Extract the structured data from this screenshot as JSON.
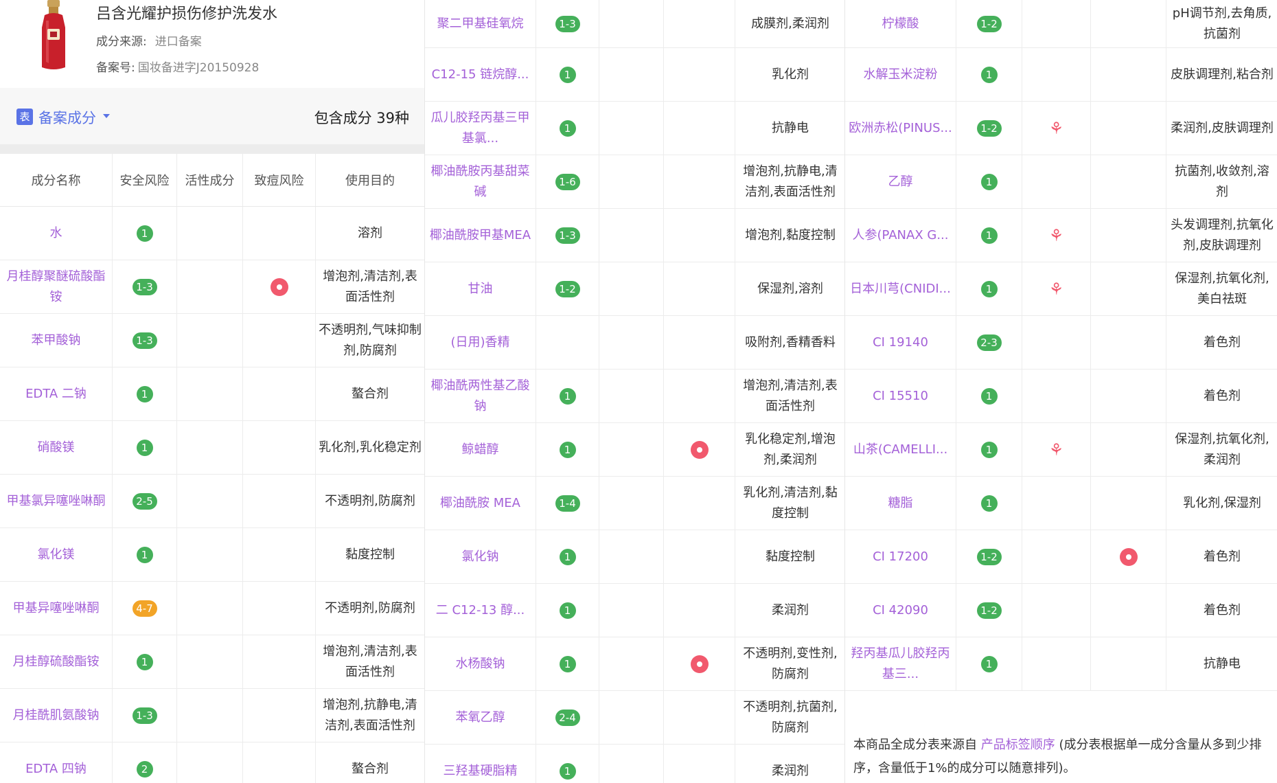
{
  "product": {
    "name": "吕含光耀护损伤修护洗发水",
    "source_label": "成分来源:",
    "source_value": "进口备案",
    "record_label": "备案号:",
    "record_value": "国妆备进字J20150928"
  },
  "section": {
    "icon_text": "表",
    "title": "备案成分",
    "count": "包含成分 39种"
  },
  "headers": [
    "成分名称",
    "安全风险",
    "活性成分",
    "致痘风险",
    "使用目的"
  ],
  "columns": [
    [
      {
        "name": "水",
        "risk": "1",
        "active": false,
        "acne": false,
        "purpose": "溶剂"
      },
      {
        "name": "月桂醇聚醚硫酸酯铵",
        "risk": "1-3",
        "active": false,
        "acne": true,
        "purpose": "增泡剂,清洁剂,表面活性剂"
      },
      {
        "name": "苯甲酸钠",
        "risk": "1-3",
        "active": false,
        "acne": false,
        "purpose": "不透明剂,气味抑制剂,防腐剂"
      },
      {
        "name": "EDTA 二钠",
        "risk": "1",
        "active": false,
        "acne": false,
        "purpose": "螯合剂"
      },
      {
        "name": "硝酸镁",
        "risk": "1",
        "active": false,
        "acne": false,
        "purpose": "乳化剂,乳化稳定剂"
      },
      {
        "name": "甲基氯异噻唑啉酮",
        "risk": "2-5",
        "active": false,
        "acne": false,
        "purpose": "不透明剂,防腐剂"
      },
      {
        "name": "氯化镁",
        "risk": "1",
        "active": false,
        "acne": false,
        "purpose": "黏度控制"
      },
      {
        "name": "甲基异噻唑啉酮",
        "risk": "4-7",
        "risk_level": "orange",
        "active": false,
        "acne": false,
        "purpose": "不透明剂,防腐剂"
      },
      {
        "name": "月桂醇硫酸酯铵",
        "risk": "1",
        "active": false,
        "acne": false,
        "purpose": "增泡剂,清洁剂,表面活性剂"
      },
      {
        "name": "月桂酰肌氨酸钠",
        "risk": "1-3",
        "active": false,
        "acne": false,
        "purpose": "增泡剂,抗静电,清洁剂,表面活性剂"
      },
      {
        "name": "EDTA 四钠",
        "risk": "2",
        "active": false,
        "acne": false,
        "purpose": "螯合剂"
      }
    ],
    [
      {
        "name": "聚二甲基硅氧烷",
        "risk": "1-3",
        "active": false,
        "acne": false,
        "purpose": "成膜剂,柔润剂"
      },
      {
        "name": "C12-15 链烷醇...",
        "risk": "1",
        "active": false,
        "acne": false,
        "purpose": "乳化剂"
      },
      {
        "name": "瓜儿胶羟丙基三甲基氯...",
        "risk": "1",
        "active": false,
        "acne": false,
        "purpose": "抗静电"
      },
      {
        "name": "椰油酰胺丙基甜菜碱",
        "risk": "1-6",
        "active": false,
        "acne": false,
        "purpose": "增泡剂,抗静电,清洁剂,表面活性剂"
      },
      {
        "name": "椰油酰胺甲基MEA",
        "risk": "1-3",
        "active": false,
        "acne": false,
        "purpose": "增泡剂,黏度控制"
      },
      {
        "name": "甘油",
        "risk": "1-2",
        "active": false,
        "acne": false,
        "purpose": "保湿剂,溶剂"
      },
      {
        "name": "(日用)香精",
        "risk": "",
        "active": false,
        "acne": false,
        "purpose": "吸附剂,香精香料"
      },
      {
        "name": "椰油酰两性基乙酸钠",
        "risk": "1",
        "active": false,
        "acne": false,
        "purpose": "增泡剂,清洁剂,表面活性剂"
      },
      {
        "name": "鲸蜡醇",
        "risk": "1",
        "active": false,
        "acne": true,
        "purpose": "乳化稳定剂,增泡剂,柔润剂"
      },
      {
        "name": "椰油酰胺 MEA",
        "risk": "1-4",
        "active": false,
        "acne": false,
        "purpose": "乳化剂,清洁剂,黏度控制"
      },
      {
        "name": "氯化钠",
        "risk": "1",
        "active": false,
        "acne": false,
        "purpose": "黏度控制"
      },
      {
        "name": "二 C12-13 醇...",
        "risk": "1",
        "active": false,
        "acne": false,
        "purpose": "柔润剂"
      },
      {
        "name": "水杨酸钠",
        "risk": "1",
        "active": false,
        "acne": true,
        "purpose": "不透明剂,变性剂,防腐剂"
      },
      {
        "name": "苯氧乙醇",
        "risk": "2-4",
        "active": false,
        "acne": false,
        "purpose": "不透明剂,抗菌剂,防腐剂"
      },
      {
        "name": "三羟基硬脂精",
        "risk": "1",
        "active": false,
        "acne": false,
        "purpose": "柔润剂"
      }
    ],
    [
      {
        "name": "柠檬酸",
        "risk": "1-2",
        "active": false,
        "acne": false,
        "purpose": "pH调节剂,去角质,抗菌剂"
      },
      {
        "name": "水解玉米淀粉",
        "risk": "1",
        "active": false,
        "acne": false,
        "purpose": "皮肤调理剂,粘合剂"
      },
      {
        "name": "欧洲赤松(PINUS...",
        "risk": "1-2",
        "active": true,
        "acne": false,
        "purpose": "柔润剂,皮肤调理剂"
      },
      {
        "name": "乙醇",
        "risk": "1",
        "active": false,
        "acne": false,
        "purpose": "抗菌剂,收敛剂,溶剂"
      },
      {
        "name": "人参(PANAX G...",
        "risk": "1",
        "active": true,
        "acne": false,
        "purpose": "头发调理剂,抗氧化剂,皮肤调理剂"
      },
      {
        "name": "日本川芎(CNIDI...",
        "risk": "1",
        "active": true,
        "acne": false,
        "purpose": "保湿剂,抗氧化剂,美白祛斑"
      },
      {
        "name": "CI 19140",
        "risk": "2-3",
        "active": false,
        "acne": false,
        "purpose": "着色剂"
      },
      {
        "name": "CI 15510",
        "risk": "1",
        "active": false,
        "acne": false,
        "purpose": "着色剂"
      },
      {
        "name": "山茶(CAMELLI...",
        "risk": "1",
        "active": true,
        "acne": false,
        "purpose": "保湿剂,抗氧化剂,柔润剂"
      },
      {
        "name": "糖脂",
        "risk": "1",
        "active": false,
        "acne": false,
        "purpose": "乳化剂,保湿剂"
      },
      {
        "name": "CI 17200",
        "risk": "1-2",
        "active": false,
        "acne": true,
        "purpose": "着色剂"
      },
      {
        "name": "CI 42090",
        "risk": "1-2",
        "active": false,
        "acne": false,
        "purpose": "着色剂"
      },
      {
        "name": "羟丙基瓜儿胶羟丙基三...",
        "risk": "1",
        "active": false,
        "acne": false,
        "purpose": "抗静电"
      }
    ]
  ],
  "note": {
    "prefix": "本商品全成分表来源自 ",
    "link": "产品标签顺序",
    "suffix": " (成分表根据单一成分含量从多到少排序，含量低于1%的成分可以随意排列)。"
  },
  "colors": {
    "accent": "#a461d8",
    "safe": "#45b05a",
    "warn": "#f2a427",
    "acne": "#f1596d",
    "brand": "#5a73e6"
  }
}
